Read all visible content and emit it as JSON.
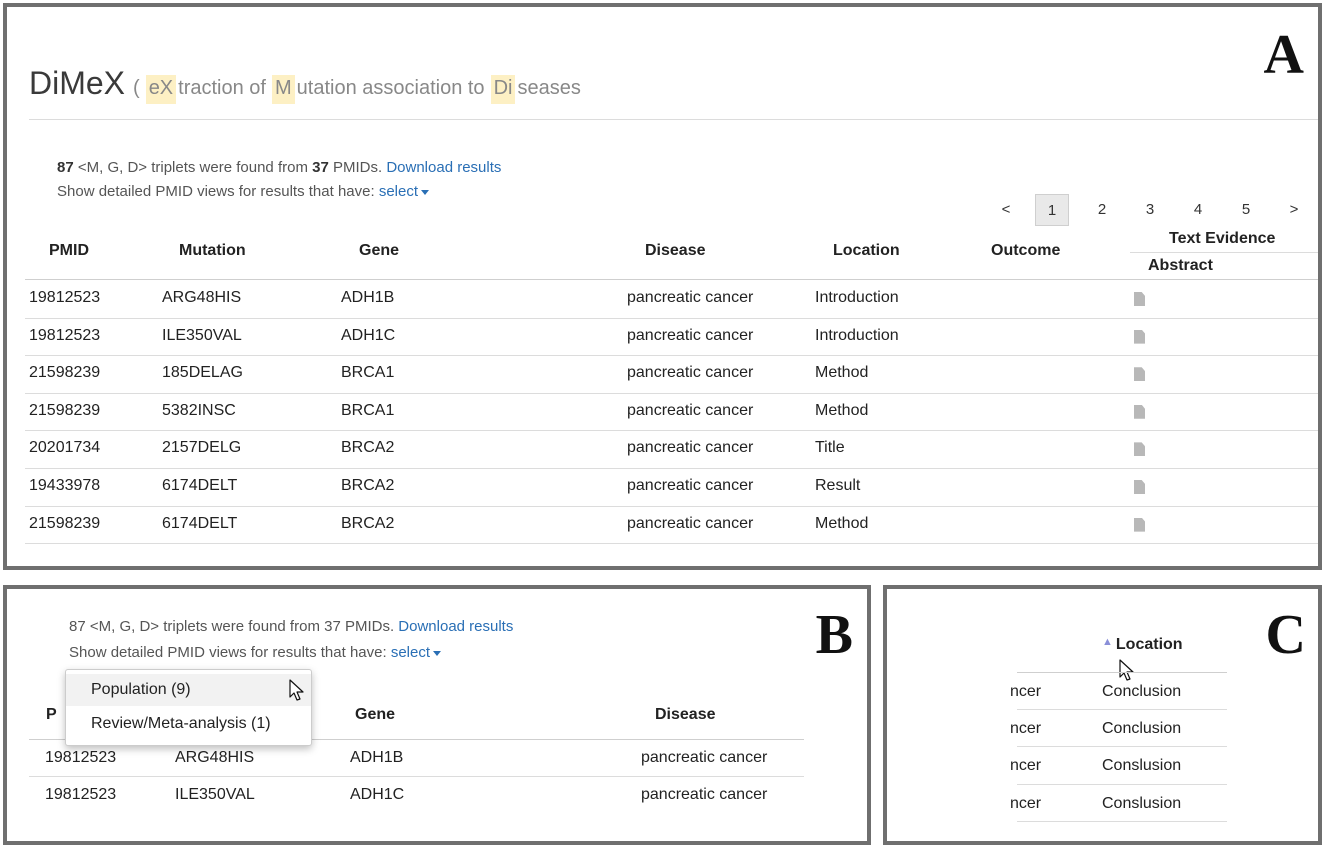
{
  "panel_a": {
    "letter": "A",
    "title": {
      "name": "DiMeX",
      "paren": "(",
      "hl1": "eX",
      "w1": "traction of",
      "hl2": "M",
      "w2": "utation association to",
      "hl3": "Di",
      "w3": "seases"
    },
    "info": {
      "count": "87",
      "triplet_text": "<M, G, D> triplets were found from",
      "pmid_count": "37",
      "pmid_text": "PMIDs.",
      "download": "Download results",
      "show_text": "Show detailed PMID views for results that have:",
      "select": "select"
    },
    "pager": [
      "<",
      "1",
      "2",
      "3",
      "4",
      "5",
      ">"
    ],
    "pager_active": "1",
    "columns": {
      "pmid": "PMID",
      "mutation": "Mutation",
      "gene": "Gene",
      "disease": "Disease",
      "location": "Location",
      "outcome": "Outcome",
      "text_evidence": "Text Evidence",
      "abstract": "Abstract"
    },
    "rows": [
      {
        "pmid": "19812523",
        "mutation": "ARG48HIS",
        "gene": "ADH1B",
        "disease": "pancreatic cancer",
        "location": "Introduction"
      },
      {
        "pmid": "19812523",
        "mutation": "ILE350VAL",
        "gene": "ADH1C",
        "disease": "pancreatic cancer",
        "location": "Introduction"
      },
      {
        "pmid": "21598239",
        "mutation": "185DELAG",
        "gene": "BRCA1",
        "disease": "pancreatic cancer",
        "location": "Method"
      },
      {
        "pmid": "21598239",
        "mutation": "5382INSC",
        "gene": "BRCA1",
        "disease": "pancreatic cancer",
        "location": "Method"
      },
      {
        "pmid": "20201734",
        "mutation": "2157DELG",
        "gene": "BRCA2",
        "disease": "pancreatic cancer",
        "location": "Title"
      },
      {
        "pmid": "19433978",
        "mutation": "6174DELT",
        "gene": "BRCA2",
        "disease": "pancreatic cancer",
        "location": "Result"
      },
      {
        "pmid": "21598239",
        "mutation": "6174DELT",
        "gene": "BRCA2",
        "disease": "pancreatic cancer",
        "location": "Method"
      }
    ]
  },
  "panel_b": {
    "letter": "B",
    "info": {
      "line1": "87 <M, G, D> triplets were found from 37 PMIDs.",
      "download": "Download results",
      "show_text": "Show detailed PMID views for results that have:",
      "select": "select"
    },
    "menu": [
      "Population (9)",
      "Review/Meta-analysis (1)"
    ],
    "columns": {
      "pmid_partial": "P",
      "gene": "Gene",
      "disease": "Disease"
    },
    "rows": [
      {
        "pmid": "19812523",
        "mutation": "ARG48HIS",
        "gene": "ADH1B",
        "disease": "pancreatic cancer"
      },
      {
        "pmid": "19812523",
        "mutation": "ILE350VAL",
        "gene": "ADH1C",
        "disease": "pancreatic cancer"
      }
    ]
  },
  "panel_c": {
    "letter": "C",
    "sort_icon": "sort-up-icon",
    "column": "Location",
    "rows": [
      {
        "disease_partial": "ncer",
        "location": "Conclusion"
      },
      {
        "disease_partial": "ncer",
        "location": "Conclusion"
      },
      {
        "disease_partial": "ncer",
        "location": "Conslusion"
      },
      {
        "disease_partial": "ncer",
        "location": "Conslusion"
      }
    ]
  },
  "colors": {
    "link": "#2a6fb5",
    "highlight": "#fdf0c4",
    "border": "#6f6f6f",
    "sort_icon": "#8a8fd8"
  }
}
